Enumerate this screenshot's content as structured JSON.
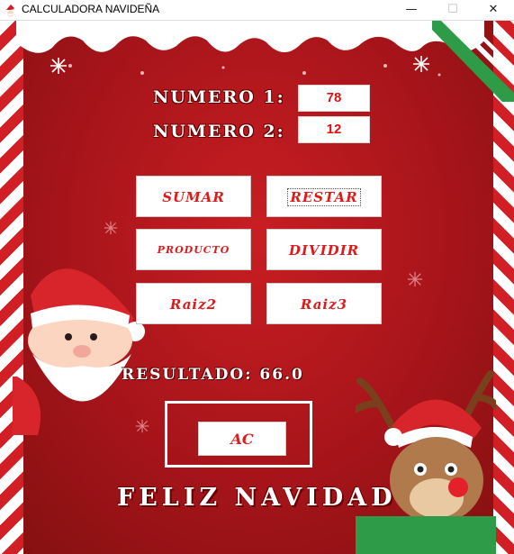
{
  "window": {
    "title": "CALCULADORA NAVIDEÑA",
    "title_icon": "santa-icon",
    "controls": {
      "minimize": "—",
      "maximize": "☐",
      "close": "✕"
    }
  },
  "inputs": {
    "numero1_label": "NUMERO 1:",
    "numero1_value": "78",
    "numero2_label": "NUMERO 2:",
    "numero2_value": "12"
  },
  "operations": {
    "sumar": "SUMAR",
    "restar": "RESTAR",
    "producto": "PRODUCTO",
    "dividir": "DIVIDIR",
    "raiz2": "Raiz2",
    "raiz3": "Raiz3"
  },
  "result": {
    "text": "RESULTADO: 66.0"
  },
  "clear_button": "AC",
  "footer": "FELIZ NAVIDAD",
  "colors": {
    "background": "#b0161c",
    "button_text": "#e01a1a",
    "field_text": "#dd1111",
    "stripe_red": "#d21f25",
    "ribbon_green": "#2e9b48"
  },
  "icons": {
    "santa": "santa-icon",
    "reindeer": "reindeer-icon",
    "snowflake": "snowflake-icon",
    "ribbon": "ribbon-icon"
  }
}
